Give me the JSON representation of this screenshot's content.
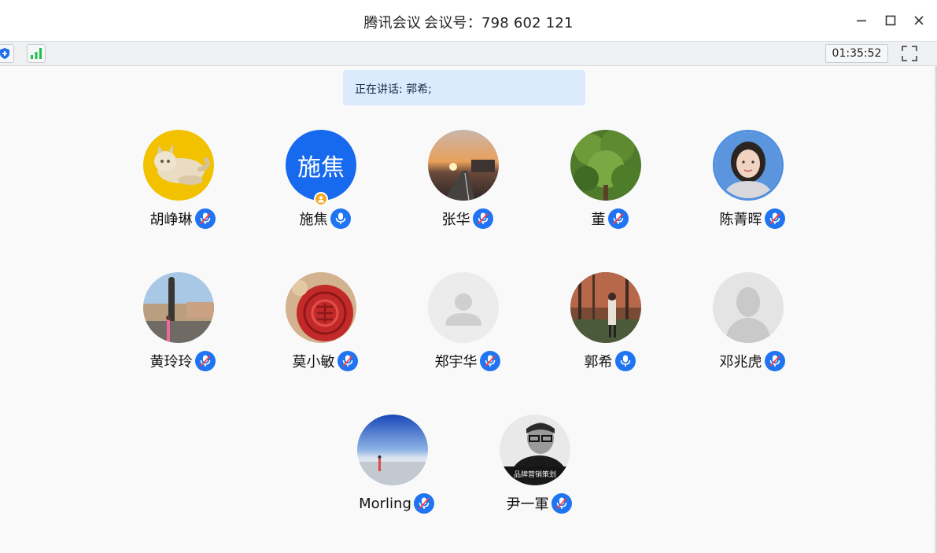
{
  "window": {
    "title_app": "腾讯会议",
    "title_meeting": "会议号：798 602 121"
  },
  "toolbar": {
    "timer": "01:35:52",
    "icons": [
      "shield-icon",
      "signal-icon",
      "fullscreen-icon"
    ]
  },
  "speaking": {
    "text": "正在讲话: 郭希;"
  },
  "colors": {
    "accent": "#1f74f2",
    "banner": "#dbeafd",
    "host_badge": "#f5a623"
  },
  "participants": [
    {
      "name": "胡峥琳",
      "avatar": "photo-cat",
      "mic": "muted"
    },
    {
      "name": "施焦",
      "avatar": "text",
      "avatar_text": "施焦",
      "mic": "on",
      "host": true
    },
    {
      "name": "张华",
      "avatar": "photo-sunset",
      "mic": "muted"
    },
    {
      "name": "董",
      "avatar": "photo-tree",
      "mic": "muted"
    },
    {
      "name": "陈菁晖",
      "avatar": "photo-portrait",
      "mic": "muted"
    },
    {
      "name": "黄玲玲",
      "avatar": "photo-bridge",
      "mic": "muted"
    },
    {
      "name": "莫小敏",
      "avatar": "photo-red-carving",
      "mic": "muted"
    },
    {
      "name": "郑宇华",
      "avatar": "default",
      "mic": "muted"
    },
    {
      "name": "郭希",
      "avatar": "photo-forest-path",
      "mic": "on"
    },
    {
      "name": "邓兆虎",
      "avatar": "default-silhouette",
      "mic": "muted"
    },
    {
      "name": "Morling",
      "avatar": "photo-sky",
      "mic": "muted"
    },
    {
      "name": "尹一軍",
      "avatar": "photo-man-glasses",
      "avatar_caption": "品牌营销策划",
      "mic": "muted"
    }
  ]
}
